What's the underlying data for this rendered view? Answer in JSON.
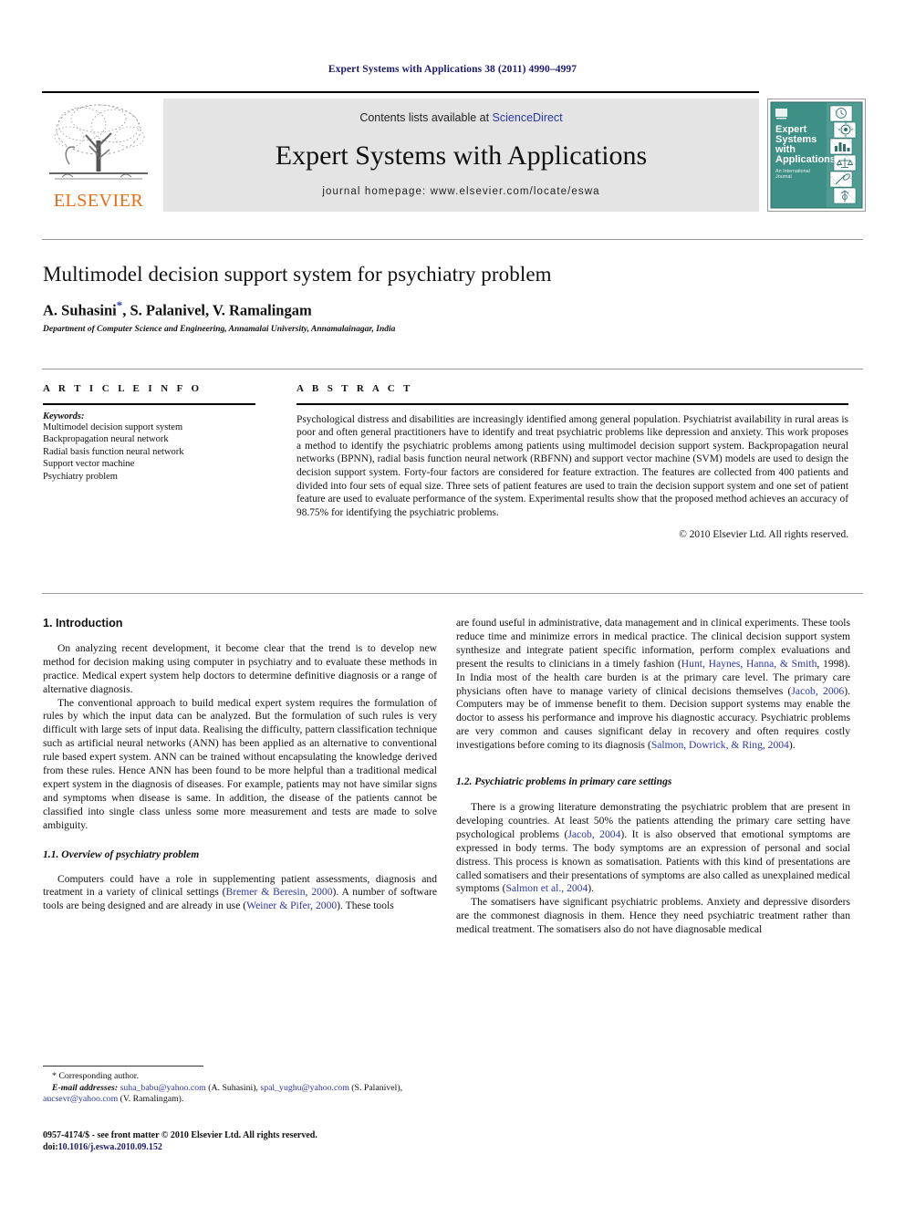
{
  "running_head": "Expert Systems with Applications 38 (2011) 4990–4997",
  "masthead": {
    "publisher_name": "ELSEVIER",
    "contents_prefix": "Contents lists available at ",
    "contents_link": "ScienceDirect",
    "journal_title": "Expert Systems with Applications",
    "homepage": "journal homepage: www.elsevier.com/locate/eswa",
    "cover": {
      "line1": "Expert",
      "line2": "Systems",
      "line3": "with",
      "line4": "Applications",
      "subtitle1": "An International",
      "subtitle2": "Journal"
    }
  },
  "paper": {
    "title": "Multimodel decision support system for psychiatry problem",
    "authors": "A. Suhasini",
    "authors_rest": ", S. Palanivel, V. Ramalingam",
    "corresponding_mark": "*",
    "affiliation": "Department of Computer Science and Engineering, Annamalai University, Annamalainagar, India"
  },
  "article_info": {
    "heading": "A R T I C L E   I N F O",
    "keywords_label": "Keywords:",
    "keywords": [
      "Multimodel decision support system",
      "Backpropagation neural network",
      "Radial basis function neural network",
      "Support vector machine",
      "Psychiatry problem"
    ]
  },
  "abstract": {
    "heading": "A B S T R A C T",
    "body": "Psychological distress and disabilities are increasingly identified among general population. Psychiatrist availability in rural areas is poor and often general practitioners have to identify and treat psychiatric problems like depression and anxiety. This work proposes a method to identify the psychiatric problems among patients using multimodel decision support system. Backpropagation neural networks (BPNN), radial basis function neural network (RBFNN) and support vector machine (SVM) models are used to design the decision support system. Forty-four factors are considered for feature extraction. The features are collected from 400 patients and divided into four sets of equal size. Three sets of patient features are used to train the decision support system and one set of patient feature are used to evaluate performance of the system. Experimental results show that the proposed method achieves an accuracy of 98.75% for identifying the psychiatric problems.",
    "copyright": "© 2010 Elsevier Ltd. All rights reserved."
  },
  "body": {
    "section1_heading": "1. Introduction",
    "left": {
      "p1": "On analyzing recent development, it become clear that the trend is to develop new method for decision making using computer in psychiatry and to evaluate these methods in practice. Medical expert system help doctors to determine definitive diagnosis or a range of alternative diagnosis.",
      "p2": "The conventional approach to build medical expert system requires the formulation of rules by which the input data can be analyzed. But the formulation of such rules is very difficult with large sets of input data. Realising the difficulty, pattern classification technique such as artificial neural networks (ANN) has been applied as an alternative to conventional rule based expert system. ANN can be trained without encapsulating the knowledge derived from these rules. Hence ANN has been found to be more helpful than a traditional medical expert system in the diagnosis of diseases. For example, patients may not have similar signs and symptoms when disease is same. In addition, the disease of the patients cannot be classified into single class unless some more measurement and tests are made to solve ambiguity.",
      "subsection11_heading": "1.1. Overview of psychiatry problem",
      "p3_a": "Computers could have a role in supplementing patient assessments, diagnosis and treatment in a variety of clinical settings (",
      "p3_cite1": "Bremer & Beresin, 2000",
      "p3_b": "). A number of software tools are being designed and are already in use (",
      "p3_cite2": "Weiner & Pifer, 2000",
      "p3_c": "). These tools"
    },
    "right": {
      "p1_a": "are found useful in administrative, data management and in clinical experiments. These tools reduce time and minimize errors in medical practice. The clinical decision support system synthesize and integrate patient specific information, perform complex evaluations and present the results to clinicians in a timely fashion (",
      "p1_cite1": "Hunt, Haynes, Hanna, & Smith",
      "p1_b": ", 1998). In India most of the health care burden is at the primary care level. The primary care physicians often have to manage variety of clinical decisions themselves (",
      "p1_cite2": "Jacob, 2006",
      "p1_c": "). Computers may be of immense benefit to them. Decision support systems may enable the doctor to assess his performance and improve his diagnostic accuracy. Psychiatric problems are very common and causes significant delay in recovery and often requires costly investigations before coming to its diagnosis (",
      "p1_cite3": "Salmon, Dowrick, & Ring, 2004",
      "p1_d": ").",
      "subsection12_heading": "1.2. Psychiatric problems in primary care settings",
      "p2_a": "There is a growing literature demonstrating the psychiatric problem that are present in developing countries. At least 50% the patients attending the primary care setting have psychological problems (",
      "p2_cite1": "Jacob, 2004",
      "p2_b": "). It is also observed that emotional symptoms are expressed in body terms. The body symptoms are an expression of personal and social distress. This process is known as somatisation. Patients with this kind of presentations are called somatisers and their presentations of symptoms are also called as unexplained medical symptoms (",
      "p2_cite2": "Salmon et al., 2004",
      "p2_c": ").",
      "p3": "The somatisers have significant psychiatric problems. Anxiety and depressive disorders are the commonest diagnosis in them. Hence they need psychiatric treatment rather than medical treatment. The somatisers also do not have diagnosable medical"
    }
  },
  "footnotes": {
    "corresponding": "* Corresponding author.",
    "email_label": "E-mail addresses:",
    "email1": "suha_babu@yahoo.com",
    "email1_owner": " (A. Suhasini), ",
    "email2": "spal_yughu@yahoo.com",
    "email2_owner": " (S. Palanivel), ",
    "email3": "aucsevr@yahoo.com",
    "email3_owner": " (V. Ramalingam)."
  },
  "issn": {
    "line1": "0957-4174/$ - see front matter © 2010 Elsevier Ltd. All rights reserved.",
    "doi_label": "doi:",
    "doi_value": "10.1016/j.eswa.2010.09.152"
  },
  "colors": {
    "link": "#2b36a8",
    "running_head": "#1a1a6e",
    "elsevier_orange": "#eb6c17",
    "band_gray": "#e4e4e4",
    "cover_teal": "#3e8f86"
  }
}
